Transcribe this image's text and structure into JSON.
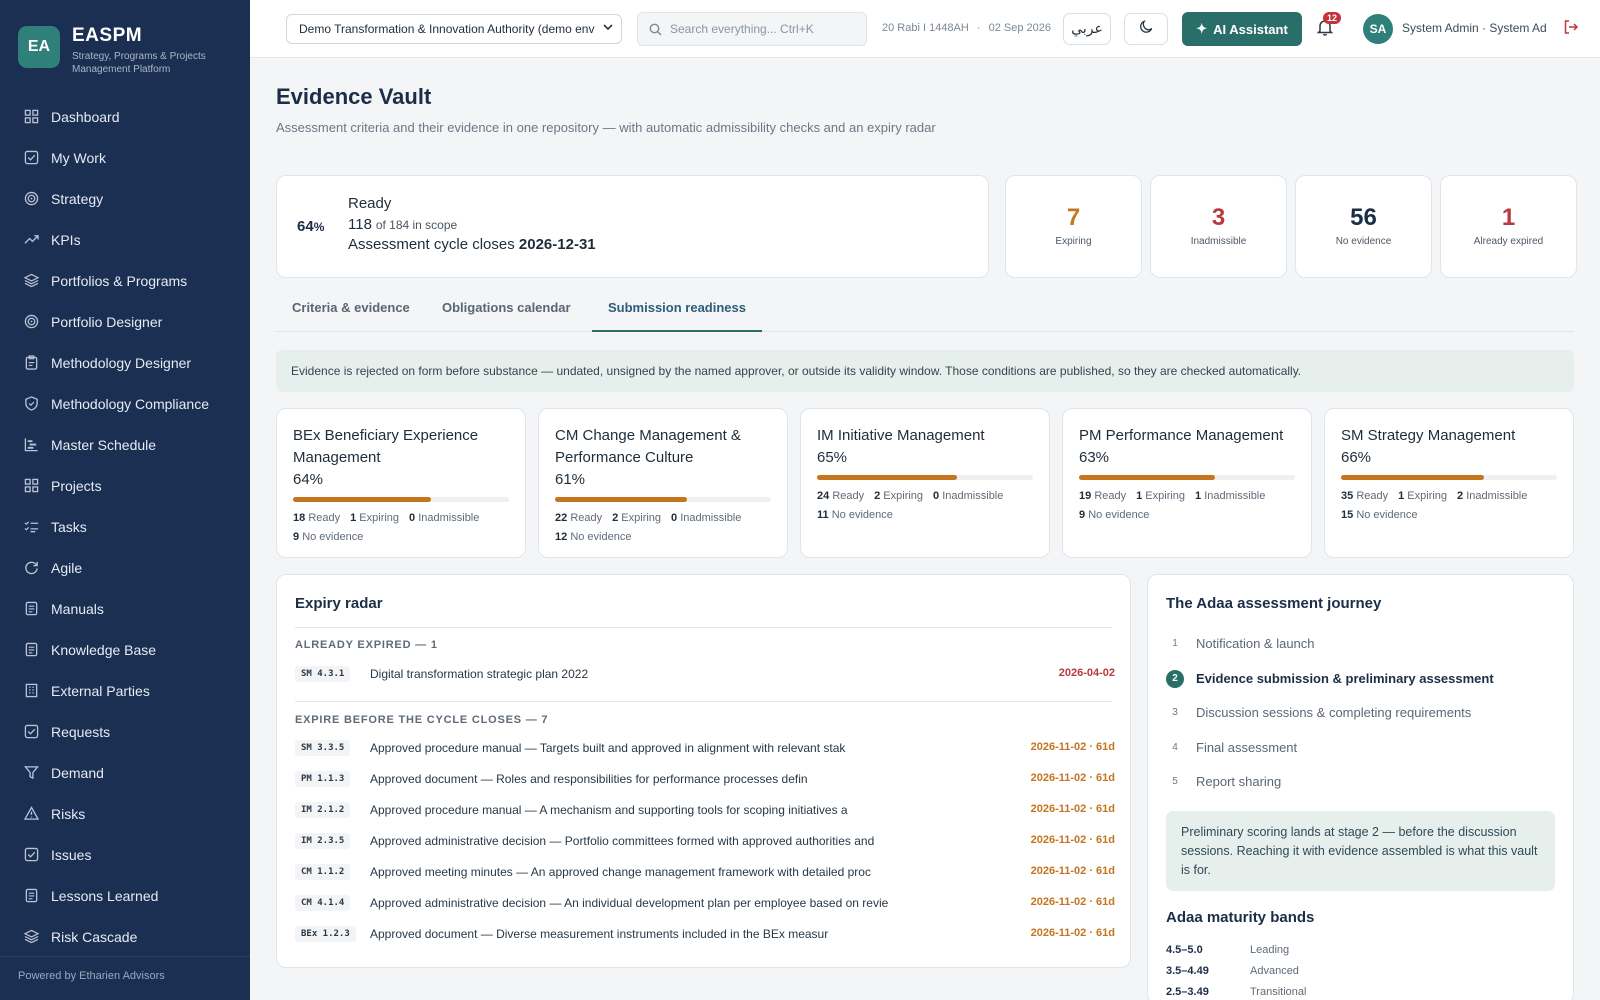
{
  "brand": {
    "logo": "EA",
    "name": "EASPM",
    "subtitle": "Strategy, Programs & Projects Management Platform"
  },
  "sidebar": {
    "items": [
      {
        "label": "Dashboard",
        "icon": "grid-icon"
      },
      {
        "label": "My Work",
        "icon": "check-square-icon"
      },
      {
        "label": "Strategy",
        "icon": "target-icon"
      },
      {
        "label": "KPIs",
        "icon": "trend-icon"
      },
      {
        "label": "Portfolios & Programs",
        "icon": "layers-icon"
      },
      {
        "label": "Portfolio Designer",
        "icon": "target-icon"
      },
      {
        "label": "Methodology Designer",
        "icon": "clipboard-icon"
      },
      {
        "label": "Methodology Compliance",
        "icon": "shield-icon"
      },
      {
        "label": "Master Schedule",
        "icon": "gantt-icon"
      },
      {
        "label": "Projects",
        "icon": "grid-icon"
      },
      {
        "label": "Tasks",
        "icon": "list-check-icon"
      },
      {
        "label": "Agile",
        "icon": "refresh-icon"
      },
      {
        "label": "Manuals",
        "icon": "document-icon"
      },
      {
        "label": "Knowledge Base",
        "icon": "document-icon"
      },
      {
        "label": "External Parties",
        "icon": "building-icon"
      },
      {
        "label": "Requests",
        "icon": "check-square-icon"
      },
      {
        "label": "Demand",
        "icon": "funnel-icon"
      },
      {
        "label": "Risks",
        "icon": "warning-icon"
      },
      {
        "label": "Issues",
        "icon": "check-square-icon"
      },
      {
        "label": "Lessons Learned",
        "icon": "document-icon"
      },
      {
        "label": "Risk Cascade",
        "icon": "layers-icon"
      }
    ],
    "footer": "Powered by Etharien Advisors"
  },
  "topbar": {
    "org": "Demo Transformation & Innovation Authority (demo env",
    "search_placeholder": "Search everything...  Ctrl+K",
    "hijri_date": "20 Rabi I 1448AH",
    "sep": "·",
    "greg_date": "02 Sep 2026",
    "lang": "عربي",
    "ai_label": "AI Assistant",
    "notifications": "12",
    "avatar": "SA",
    "user": "System Admin · System Administrator"
  },
  "page": {
    "title": "Evidence Vault",
    "subtitle": "Assessment criteria and their evidence in one repository — with automatic admissibility checks and an expiry radar"
  },
  "summary": {
    "pct": "64",
    "pct_unit": "%",
    "label": "Ready",
    "ready_count": "118",
    "of_total": "of 184 in scope",
    "cycle_label": "Assessment cycle closes",
    "cycle_date": "2026-12-31"
  },
  "stats": [
    {
      "num": "7",
      "label": "Expiring",
      "color": "#c5741f"
    },
    {
      "num": "3",
      "label": "Inadmissible",
      "color": "#b83a3f"
    },
    {
      "num": "56",
      "label": "No evidence",
      "color": "#1c2e47"
    },
    {
      "num": "1",
      "label": "Already expired",
      "color": "#b83a3f"
    }
  ],
  "tabs": [
    "Criteria & evidence",
    "Obligations calendar",
    "Submission readiness"
  ],
  "active_tab": "Submission readiness",
  "banner": "Evidence is rejected on form before substance — undated, unsigned by the named approver, or outside its validity window. Those conditions are published, so they are checked automatically.",
  "areas": [
    {
      "name": "BEx Beneficiary Experience Management",
      "pct": "64%",
      "fill": 0.64,
      "ready": "18",
      "expiring": "1",
      "inadmissible": "0",
      "no_evidence": "9"
    },
    {
      "name": "CM Change Management & Performance Culture",
      "pct": "61%",
      "fill": 0.61,
      "ready": "22",
      "expiring": "2",
      "inadmissible": "0",
      "no_evidence": "12"
    },
    {
      "name": "IM Initiative Management",
      "pct": "65%",
      "fill": 0.65,
      "ready": "24",
      "expiring": "2",
      "inadmissible": "0",
      "no_evidence": "11"
    },
    {
      "name": "PM Performance Management",
      "pct": "63%",
      "fill": 0.63,
      "ready": "19",
      "expiring": "1",
      "inadmissible": "1",
      "no_evidence": "9"
    },
    {
      "name": "SM Strategy Management",
      "pct": "66%",
      "fill": 0.66,
      "ready": "35",
      "expiring": "1",
      "inadmissible": "2",
      "no_evidence": "15"
    }
  ],
  "area_labels": {
    "ready": "Ready",
    "expiring": "Expiring",
    "inadmissible": "Inadmissible",
    "no_evidence": "No evidence"
  },
  "radar": {
    "title": "Expiry radar",
    "expired_heading": "ALREADY EXPIRED — 1",
    "expired": [
      {
        "code": "SM 4.3.1",
        "desc": "Digital transformation strategic plan 2022",
        "date": "2026-04-02"
      }
    ],
    "expiring_heading": "EXPIRE BEFORE THE CYCLE CLOSES — 7",
    "expiring": [
      {
        "code": "SM 3.3.5",
        "desc": "Approved procedure manual — Targets built and approved in alignment with relevant stak",
        "date": "2026-11-02 · 61d"
      },
      {
        "code": "PM 1.1.3",
        "desc": "Approved document — Roles and responsibilities for performance processes defin",
        "date": "2026-11-02 · 61d"
      },
      {
        "code": "IM 2.1.2",
        "desc": "Approved procedure manual — A mechanism and supporting tools for scoping initiatives a",
        "date": "2026-11-02 · 61d"
      },
      {
        "code": "IM 2.3.5",
        "desc": "Approved administrative decision — Portfolio committees formed with approved authorities and",
        "date": "2026-11-02 · 61d"
      },
      {
        "code": "CM 1.1.2",
        "desc": "Approved meeting minutes — An approved change management framework with detailed proc",
        "date": "2026-11-02 · 61d"
      },
      {
        "code": "CM 4.1.4",
        "desc": "Approved administrative decision — An individual development plan per employee based on revie",
        "date": "2026-11-02 · 61d"
      },
      {
        "code": "BEx 1.2.3",
        "desc": "Approved document — Diverse measurement instruments included in the BEx measur",
        "date": "2026-11-02 · 61d"
      }
    ],
    "expired_color": "#b83a3f",
    "expiring_color": "#c5741f"
  },
  "journey": {
    "title": "The Adaa assessment journey",
    "stages": [
      "Notification & launch",
      "Evidence submission & preliminary assessment",
      "Discussion sessions & completing requirements",
      "Final assessment",
      "Report sharing"
    ],
    "active_stage": 2,
    "note": "Preliminary scoring lands at stage 2 — before the discussion sessions. Reaching it with evidence assembled is what this vault is for.",
    "bands_title": "Adaa maturity bands",
    "bands": [
      {
        "range": "4.5–5.0",
        "label": "Leading"
      },
      {
        "range": "3.5–4.49",
        "label": "Advanced"
      },
      {
        "range": "2.5–3.49",
        "label": "Transitional"
      }
    ]
  }
}
